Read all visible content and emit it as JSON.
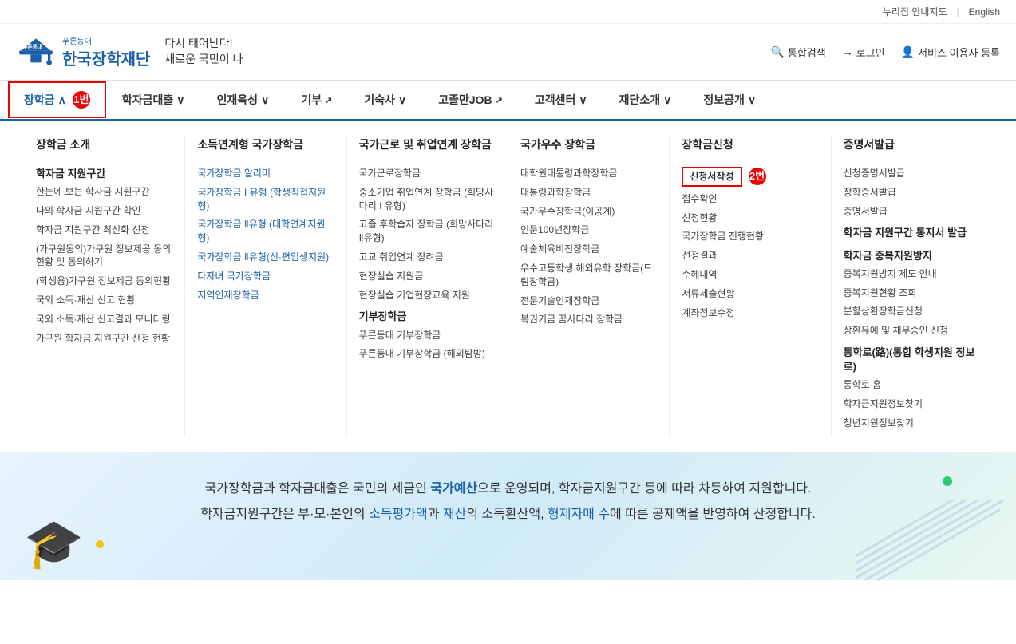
{
  "topbar": {
    "nurijip": "누리집 안내지도",
    "english": "English",
    "divider": "|"
  },
  "header": {
    "logo_top": "푸른등대",
    "logo_main": "한국장학재단",
    "slogan_line1": "다시 태어난다!",
    "slogan_line2": "새로운 국민이 나",
    "search_label": "통합검색",
    "login_label": "로그인",
    "register_label": "서비스 이용자 등록"
  },
  "nav": {
    "items": [
      {
        "id": "scholarship",
        "label": "장학금",
        "chevron": "∧",
        "active": true,
        "badge": "1번"
      },
      {
        "id": "loan",
        "label": "학자금대출",
        "chevron": "∨",
        "active": false
      },
      {
        "id": "talent",
        "label": "인재육성",
        "chevron": "∨",
        "active": false
      },
      {
        "id": "donation",
        "label": "기부",
        "ext": true,
        "active": false
      },
      {
        "id": "dormitory",
        "label": "기숙사",
        "chevron": "∨",
        "active": false
      },
      {
        "id": "jobs",
        "label": "고졸만JOB",
        "ext": true,
        "active": false
      },
      {
        "id": "customer",
        "label": "고객센터",
        "chevron": "∨",
        "active": false
      },
      {
        "id": "foundation",
        "label": "재단소개",
        "chevron": "∨",
        "active": false
      },
      {
        "id": "info",
        "label": "정보공개",
        "chevron": "∨",
        "active": false
      }
    ]
  },
  "mega_menu": {
    "col1": {
      "title": "장학금 소개",
      "sub_title": "학자금 지원구간",
      "links": [
        "한눈에 보는 학자금 지원구간",
        "나의 학자금 지원구간 확인",
        "학자금 지원구간 최신화 신청",
        "(가구원동의)가구원 정보제공 동의현황 및 동의하기",
        "(학생용)가구원 정보제공 동의현황",
        "국외 소득·재산 신고 현황",
        "국외 소득·재산 신고결과 모니터링",
        "가구원 학자금 지원구간 산정 현황"
      ]
    },
    "col2": {
      "title": "소득연계형 국가장학금",
      "links": [
        "국가장학금 알리미",
        "국가장학금 I 유형 (학생직접지원형)",
        "국가장학금 Ⅱ유형 (대학연계지원형)",
        "국가장학금 Ⅱ유형(신·편입생지원)",
        "다자녀 국가장학금",
        "지역인재장학금"
      ]
    },
    "col3": {
      "title": "국가근로 및 취업연계 장학금",
      "links": [
        "국가근로장학금",
        "중소기업 취업연계 장학금 (희망사다리 I 유형)",
        "고졸 후학습자 장학금 (희망사다리 Ⅱ유형)",
        "고교 취업연계 장려금",
        "현장실습 지원금",
        "현장실습 기업현장교육 지원"
      ],
      "sub_title": "기부장학금",
      "sub_links": [
        "푸른등대 기부장학금",
        "푸른등대 기부장학금 (해외탐방)"
      ]
    },
    "col4": {
      "title": "국가우수 장학금",
      "links": [
        "대학원대통령과학장학금",
        "대통령과학장학금",
        "국가우수장학금(이공계)",
        "인문100년장학금",
        "예술체육비전장학금",
        "우수고등학생 해외유학 장학금(드림장학금)",
        "전문기술인재장학금",
        "복권기금 꿈사다리 장학금"
      ]
    },
    "col5": {
      "title": "장학금신청",
      "links": [
        "신청서작성",
        "접수확인",
        "신청현황",
        "국가장학금 진행현황",
        "선정결과",
        "수혜내역",
        "서류제출현황",
        "계좌정보수정"
      ],
      "highlighted_link": "신청서작성",
      "badge": "2번"
    },
    "col6": {
      "title": "증명서발급",
      "links": [
        "신청증명서발급",
        "장학증서발급",
        "증명서발급"
      ],
      "sub_title1": "학자금 지원구간 통지서 발급",
      "sub_title2": "학자금 중복지원방지",
      "sub_links2": [
        "중복지원방지 제도 안내",
        "중복지원현황 조회",
        "분할상환장학금신청",
        "상환유예 및 채무승인 신청"
      ],
      "sub_title3": "통학로(路)(통합 학생지원 정보로)",
      "sub_links3": [
        "통학로 홈",
        "학자금지원정보찾기",
        "청년지원정보찾기"
      ]
    }
  },
  "banner": {
    "line1_prefix": "국가장학금과 학자금대출은 국민의 세금인 ",
    "line1_highlight": "국가예산",
    "line1_suffix": "으로 운영되며, 학자금지원구간 등에 따라 차등하여 지원합니다.",
    "line2_prefix": "학자금지원구간은 부·모·본인의 ",
    "line2_h1": "소득평가액",
    "line2_mid": "과 ",
    "line2_h2": "재산",
    "line2_mid2": "의 소득환산액, ",
    "line2_h3": "형제자매 수",
    "line2_suffix": "에 따른 공제액을 반영하여 산정합니다."
  }
}
